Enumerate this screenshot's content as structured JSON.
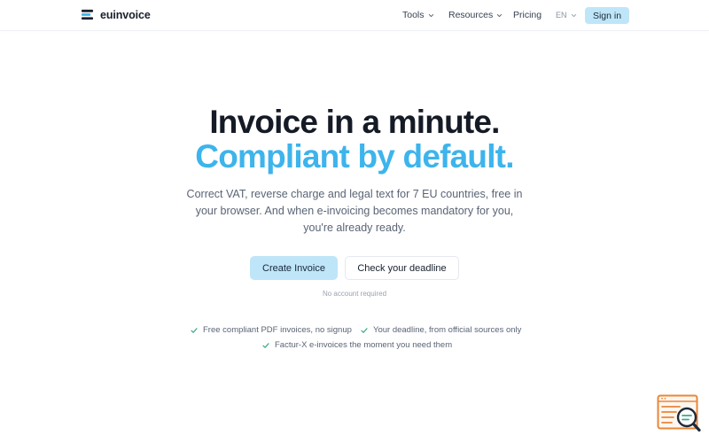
{
  "brand": {
    "name": "euinvoice",
    "icon": "stacked-lines-logo-icon",
    "colors": {
      "dark": "#1a2233",
      "accent": "#3db4ec"
    }
  },
  "nav": {
    "tools_label": "Tools",
    "resources_label": "Resources",
    "pricing_label": "Pricing",
    "language": "EN",
    "signin_label": "Sign in"
  },
  "hero": {
    "title_line1": "Invoice in a minute.",
    "title_line2": "Compliant by default.",
    "subtitle_line1": "Correct VAT, reverse charge and legal text for 7 EU countries, free in",
    "subtitle_line2": "your browser. And when e-invoicing becomes mandatory for you,",
    "subtitle_line3": "you're already ready."
  },
  "cta": {
    "primary_label": "Create Invoice",
    "secondary_label": "Check your deadline",
    "note": "No account required"
  },
  "features": [
    {
      "label": "Free compliant PDF invoices, no signup",
      "icon": "check-icon"
    },
    {
      "label": "Your deadline, from official sources only",
      "icon": "check-icon"
    },
    {
      "label": "Factur-X e-invoices the moment you need them",
      "icon": "check-icon"
    }
  ],
  "widget": {
    "icon": "document-search-icon"
  },
  "colors": {
    "accent": "#3db4ec",
    "button_bg": "#bfe5f8",
    "check": "#3da88c",
    "widget_orange": "#e8873a"
  }
}
